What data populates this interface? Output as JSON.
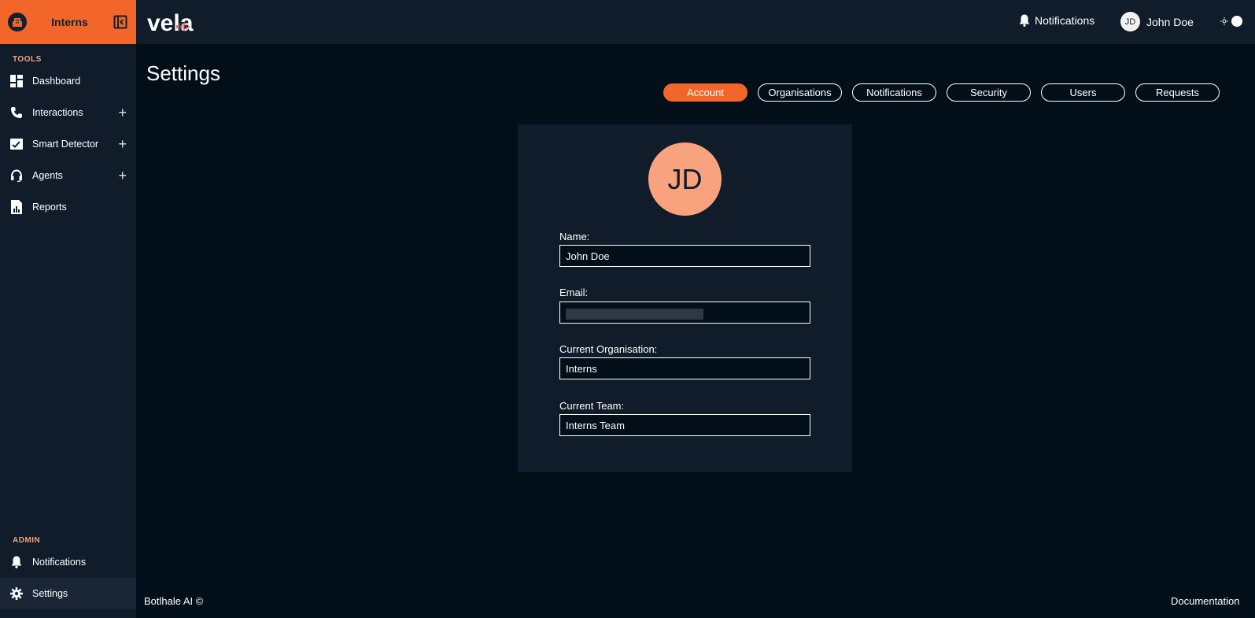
{
  "sidebar": {
    "org_name": "Interns",
    "tools_label": "TOOLS",
    "admin_label": "ADMIN",
    "tools_items": [
      {
        "label": "Dashboard",
        "icon": "dashboard-icon"
      },
      {
        "label": "Interactions",
        "icon": "phone-icon",
        "expandable": true
      },
      {
        "label": "Smart Detector",
        "icon": "chart-check-icon",
        "expandable": true
      },
      {
        "label": "Agents",
        "icon": "headset-icon",
        "expandable": true
      },
      {
        "label": "Reports",
        "icon": "report-icon"
      }
    ],
    "admin_items": [
      {
        "label": "Notifications",
        "icon": "bell-icon"
      },
      {
        "label": "Settings",
        "icon": "gear-icon",
        "active": true
      }
    ],
    "plus": "+"
  },
  "topbar": {
    "logo_text": "vela",
    "notifications_label": "Notifications",
    "user_initials": "JD",
    "user_name": "John Doe",
    "theme_icon": "sun-icon"
  },
  "main": {
    "title": "Settings",
    "tabs": [
      {
        "label": "Account",
        "active": true
      },
      {
        "label": "Organisations"
      },
      {
        "label": "Notifications"
      },
      {
        "label": "Security"
      },
      {
        "label": "Users"
      },
      {
        "label": "Requests"
      }
    ],
    "profile": {
      "avatar_initials": "JD",
      "fields": {
        "name_label": "Name:",
        "name_value": "John Doe",
        "email_label": "Email:",
        "email_value": "",
        "org_label": "Current Organisation:",
        "org_value": "Interns",
        "team_label": "Current Team:",
        "team_value": "Interns Team"
      }
    }
  },
  "footer": {
    "copyright": "Botlhale AI ©",
    "documentation": "Documentation"
  },
  "colors": {
    "accent": "#f2662a",
    "avatar": "#f9a27e",
    "background": "#020f19",
    "panel": "#101c2a"
  }
}
